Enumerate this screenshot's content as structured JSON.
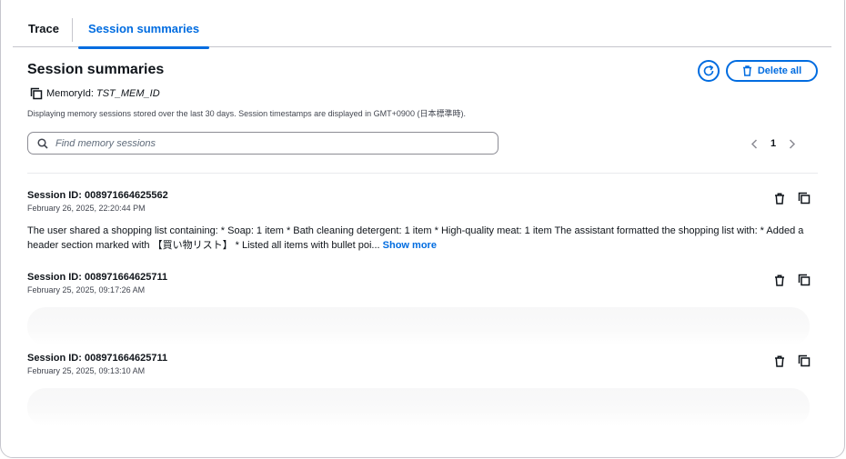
{
  "tabs": [
    {
      "label": "Trace"
    },
    {
      "label": "Session summaries"
    }
  ],
  "header": {
    "title": "Session summaries",
    "memory_label": "MemoryId:",
    "memory_value": "TST_MEM_ID",
    "description": "Displaying memory sessions stored over the last 30 days. Session timestamps are displayed in GMT+0900 (日本標準時).",
    "delete_all_label": "Delete all"
  },
  "search": {
    "placeholder": "Find memory sessions",
    "value": ""
  },
  "pagination": {
    "current_page": "1"
  },
  "sessions": [
    {
      "id_label": "Session ID: 008971664625562",
      "date": "February 26, 2025, 22:20:44 PM",
      "summary": "The user shared a shopping list containing: * Soap: 1 item * Bath cleaning detergent: 1 item * High-quality meat: 1 item The assistant formatted the shopping list with: * Added a header section marked with 【買い物リスト】 * Listed all items with bullet poi...",
      "show_more_label": "Show more"
    },
    {
      "id_label": "Session ID: 008971664625711",
      "date": "February 25, 2025, 09:17:26 AM"
    },
    {
      "id_label": "Session ID: 008971664625711",
      "date": "February 25, 2025, 09:13:10 AM"
    }
  ],
  "icons": {
    "copy": "copy-icon",
    "refresh": "refresh-icon",
    "trash": "trash-icon",
    "search": "search-icon",
    "prev": "chevron-left-icon",
    "next": "chevron-right-icon"
  },
  "colors": {
    "accent": "#006ce0",
    "text": "#0f141a",
    "secondary_text": "#424650",
    "border": "#c6c6cd"
  }
}
